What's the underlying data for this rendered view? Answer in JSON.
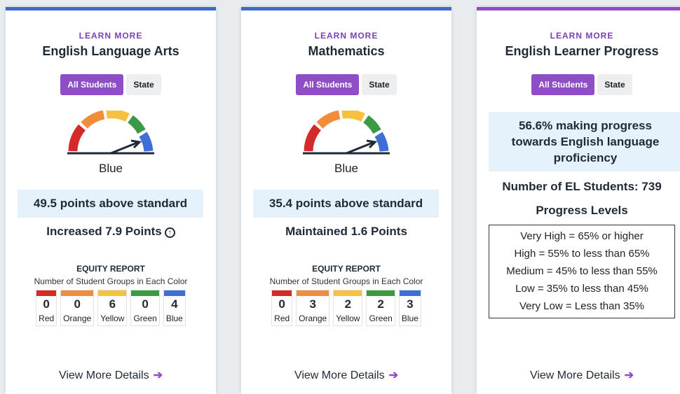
{
  "colors": {
    "red": "#d42a2a",
    "orange": "#f08c3a",
    "yellow": "#f5c13f",
    "green": "#3a9a45",
    "blue": "#3f6fd6",
    "purple": "#8e4ec6",
    "topbar_blue": "#3d6bc9",
    "topbar_purple": "#9848c8"
  },
  "cards": [
    {
      "learn_more": "LEARN MORE",
      "title": "English Language Arts",
      "toggle": {
        "active": "All Students",
        "inactive": "State"
      },
      "gauge_color": "Blue",
      "status": "49.5 points above standard",
      "change": "Increased 7.9 Points",
      "change_icon": "arrow-up-circle-icon",
      "equity_title": "EQUITY REPORT",
      "equity_subtitle": "Number of Student Groups in Each Color",
      "equity": [
        {
          "label": "Red",
          "count": "0"
        },
        {
          "label": "Orange",
          "count": "0"
        },
        {
          "label": "Yellow",
          "count": "6"
        },
        {
          "label": "Green",
          "count": "0"
        },
        {
          "label": "Blue",
          "count": "4"
        }
      ],
      "view_more": "View More Details"
    },
    {
      "learn_more": "LEARN MORE",
      "title": "Mathematics",
      "toggle": {
        "active": "All Students",
        "inactive": "State"
      },
      "gauge_color": "Blue",
      "status": "35.4 points above standard",
      "change": "Maintained 1.6 Points",
      "equity_title": "EQUITY REPORT",
      "equity_subtitle": "Number of Student Groups in Each Color",
      "equity": [
        {
          "label": "Red",
          "count": "0"
        },
        {
          "label": "Orange",
          "count": "3"
        },
        {
          "label": "Yellow",
          "count": "2"
        },
        {
          "label": "Green",
          "count": "2"
        },
        {
          "label": "Blue",
          "count": "3"
        }
      ],
      "view_more": "View More Details"
    },
    {
      "learn_more": "LEARN MORE",
      "title": "English Learner Progress",
      "toggle": {
        "active": "All Students",
        "inactive": "State"
      },
      "progress_text": "56.6% making progress towards English language proficiency",
      "el_count": "Number of EL Students: 739",
      "levels_title": "Progress Levels",
      "levels": [
        "Very High = 65% or higher",
        "High = 55% to less than 65%",
        "Medium = 45% to less than 55%",
        "Low = 35% to less than 45%",
        "Very Low = Less than 35%"
      ],
      "view_more": "View More Details"
    }
  ]
}
